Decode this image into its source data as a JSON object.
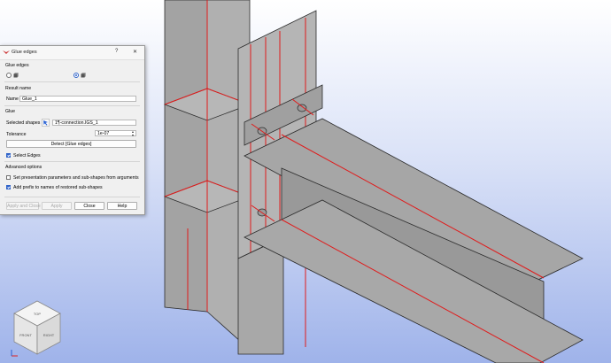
{
  "dialog": {
    "title": "Glue edges",
    "help_glyph": "?",
    "close_glyph": "✕",
    "section_glue_edges": "Glue edges",
    "section_result_name": "Result name",
    "name_label": "Name",
    "name_value": "Glue_1",
    "section_glue": "Glue",
    "selected_shapes_label": "Selected shapes",
    "selected_shapes_value": "1¶-connection.IGS_1",
    "tolerance_label": "Tolerance",
    "tolerance_value": "1e-07",
    "detect_button": "Detect [Glue edges]",
    "select_edges_label": "Select Edges",
    "select_edges_checked": true,
    "section_advanced": "Advanced options",
    "set_presentation_label": "Set presentation parameters and sub-shapes from arguments",
    "set_presentation_checked": false,
    "add_prefix_label": "Add prefix to names of restored sub-shapes",
    "add_prefix_checked": true,
    "buttons": {
      "apply_close": "Apply and Close",
      "apply": "Apply",
      "close": "Close",
      "help": "Help"
    },
    "mode_selected": 2
  },
  "viewcube": {
    "top": "TOP",
    "front": "FRONT",
    "right": "RIGHT"
  },
  "colors": {
    "steel_face": "#a6a6a6",
    "steel_face_light": "#b3b3b3",
    "steel_face_dark": "#8e8e8e",
    "edge_outline": "#2b2b2b",
    "edge_highlight": "#e01b1b",
    "accent": "#2f63c9"
  }
}
